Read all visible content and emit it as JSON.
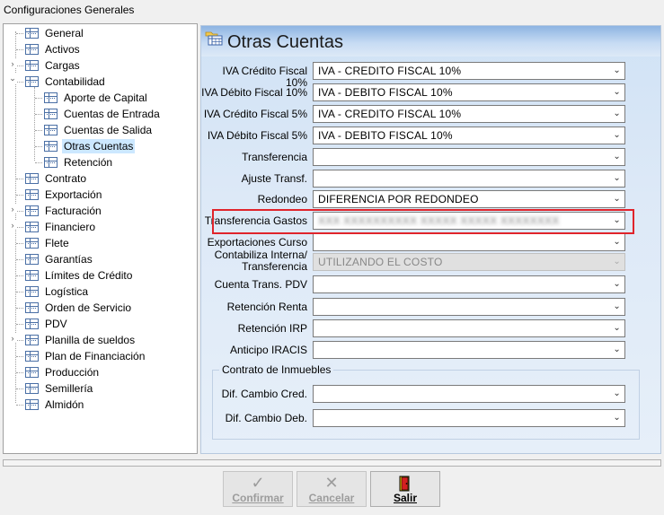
{
  "window": {
    "title": "Configuraciones Generales"
  },
  "tree": {
    "items": [
      {
        "label": "General",
        "level": 0,
        "expander": ""
      },
      {
        "label": "Activos",
        "level": 0,
        "expander": ""
      },
      {
        "label": "Cargas",
        "level": 0,
        "expander": "›"
      },
      {
        "label": "Contabilidad",
        "level": 0,
        "expander": "⌄"
      },
      {
        "label": "Aporte de Capital",
        "level": 1,
        "expander": ""
      },
      {
        "label": "Cuentas de Entrada",
        "level": 1,
        "expander": ""
      },
      {
        "label": "Cuentas de Salida",
        "level": 1,
        "expander": ""
      },
      {
        "label": "Otras Cuentas",
        "level": 1,
        "expander": "",
        "selected": true
      },
      {
        "label": "Retención",
        "level": 1,
        "expander": ""
      },
      {
        "label": "Contrato",
        "level": 0,
        "expander": ""
      },
      {
        "label": "Exportación",
        "level": 0,
        "expander": ""
      },
      {
        "label": "Facturación",
        "level": 0,
        "expander": "›"
      },
      {
        "label": "Financiero",
        "level": 0,
        "expander": "›"
      },
      {
        "label": "Flete",
        "level": 0,
        "expander": ""
      },
      {
        "label": "Garantías",
        "level": 0,
        "expander": ""
      },
      {
        "label": "Límites de Crédito",
        "level": 0,
        "expander": ""
      },
      {
        "label": "Logística",
        "level": 0,
        "expander": ""
      },
      {
        "label": "Orden de Servicio",
        "level": 0,
        "expander": ""
      },
      {
        "label": "PDV",
        "level": 0,
        "expander": ""
      },
      {
        "label": "Planilla de sueldos",
        "level": 0,
        "expander": "›"
      },
      {
        "label": "Plan de Financiación",
        "level": 0,
        "expander": ""
      },
      {
        "label": "Producción",
        "level": 0,
        "expander": ""
      },
      {
        "label": "Semillería",
        "level": 0,
        "expander": ""
      },
      {
        "label": "Almidón",
        "level": 0,
        "expander": ""
      }
    ]
  },
  "panel": {
    "title": "Otras Cuentas",
    "fields": [
      {
        "label": "IVA Crédito Fiscal 10%",
        "value": "IVA - CREDITO FISCAL 10%"
      },
      {
        "label": "IVA Débito Fiscal 10%",
        "value": "IVA - DEBITO FISCAL 10%"
      },
      {
        "label": "IVA Crédito Fiscal 5%",
        "value": "IVA - CREDITO FISCAL 10%"
      },
      {
        "label": "IVA Débito Fiscal 5%",
        "value": "IVA - DEBITO FISCAL 10%"
      },
      {
        "label": "Transferencia",
        "value": ""
      },
      {
        "label": "Ajuste Transf.",
        "value": ""
      },
      {
        "label": "Redondeo",
        "value": "DIFERENCIA POR REDONDEO"
      },
      {
        "label": "Transferencia Gastos",
        "value": "XXX XXXXXXXXXX XXXXX XXXXX XXXXXXXX",
        "blurred": true
      },
      {
        "label": "Exportaciones Curso",
        "value": ""
      },
      {
        "label": "Contabiliza Interna/ Transferencia",
        "value": "UTILIZANDO EL COSTO",
        "disabled": true
      },
      {
        "label": "Cuenta Trans. PDV",
        "value": ""
      },
      {
        "label": "Retención Renta",
        "value": ""
      },
      {
        "label": "Retención IRP",
        "value": ""
      },
      {
        "label": "Anticipo IRACIS",
        "value": ""
      }
    ],
    "group": {
      "title": "Contrato de Inmuebles",
      "fields": [
        {
          "label": "Dif. Cambio Cred.",
          "value": ""
        },
        {
          "label": "Dif. Cambio Deb.",
          "value": ""
        }
      ]
    }
  },
  "buttons": {
    "confirm": {
      "label": "Confirmar",
      "icon": "check-icon"
    },
    "cancel": {
      "label": "Cancelar",
      "icon": "x-icon"
    },
    "exit": {
      "label": "Salir",
      "icon": "exit-door-icon"
    }
  },
  "colors": {
    "highlight": "#e0242b",
    "selection": "#cce8ff"
  }
}
